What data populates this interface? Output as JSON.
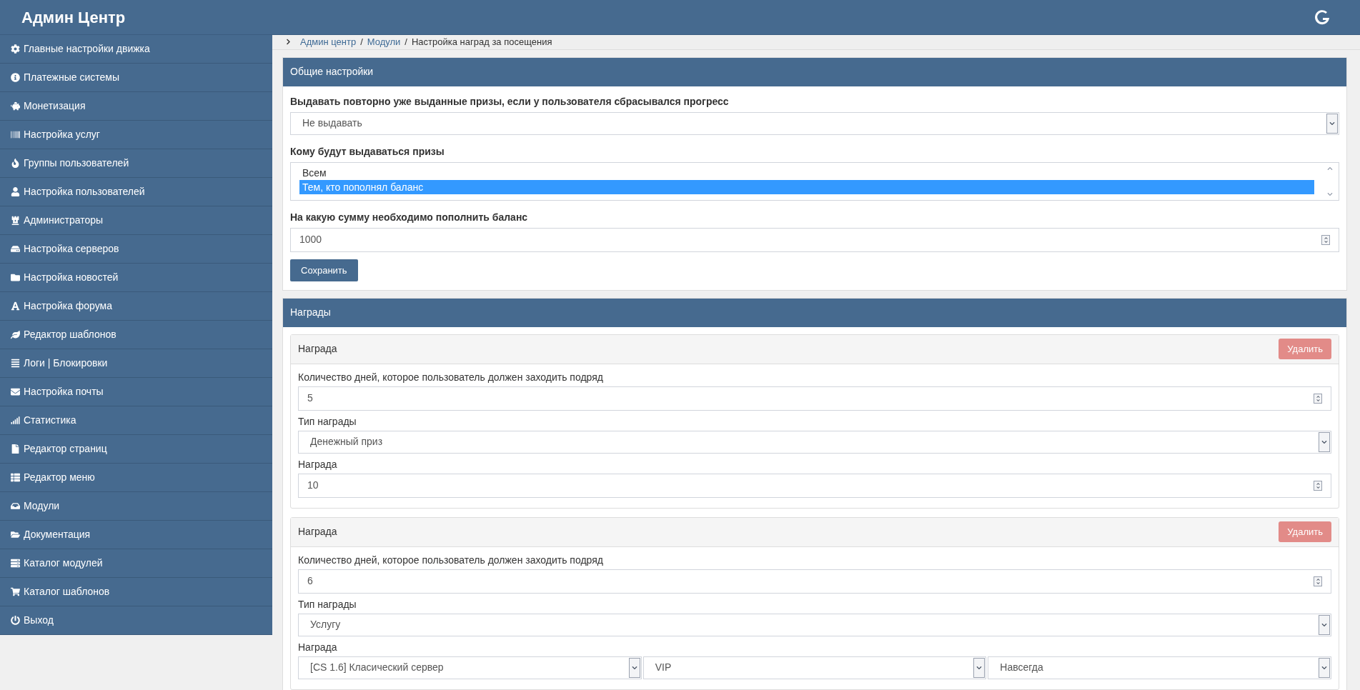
{
  "header": {
    "title": "Админ Центр"
  },
  "sidebar": {
    "items": [
      {
        "label": "Главные настройки движка"
      },
      {
        "label": "Платежные системы"
      },
      {
        "label": "Монетизация"
      },
      {
        "label": "Настройка услуг"
      },
      {
        "label": "Группы пользователей"
      },
      {
        "label": "Настройка пользователей"
      },
      {
        "label": "Администраторы"
      },
      {
        "label": "Настройка серверов"
      },
      {
        "label": "Настройка новостей"
      },
      {
        "label": "Настройка форума"
      },
      {
        "label": "Редактор шаблонов"
      },
      {
        "label": "Логи | Блокировки"
      },
      {
        "label": "Настройка почты"
      },
      {
        "label": "Статистика"
      },
      {
        "label": "Редактор страниц"
      },
      {
        "label": "Редактор меню"
      },
      {
        "label": "Модули"
      },
      {
        "label": "Документация"
      },
      {
        "label": "Каталог модулей"
      },
      {
        "label": "Каталог шаблонов"
      },
      {
        "label": "Выход"
      }
    ]
  },
  "breadcrumb": {
    "links": [
      "Админ центр",
      "Модули"
    ],
    "separator": "/",
    "current": "Настройка наград за посещения"
  },
  "general_settings": {
    "title": "Общие настройки",
    "fields": [
      {
        "kind": "select",
        "label": "Выдавать повторно уже выданные призы, если у пользователя сбрасывался прогресс",
        "value": "Не выдавать"
      },
      {
        "kind": "listbox",
        "label": "Кому будут выдаваться призы",
        "options": [
          {
            "label": "Всем",
            "selected": false
          },
          {
            "label": "Тем, кто пополнял баланс",
            "selected": true
          }
        ]
      },
      {
        "kind": "number",
        "label": "На какую сумму необходимо пополнить баланс",
        "value": "1000"
      }
    ],
    "save_button": "Сохранить"
  },
  "rewards": {
    "title": "Награды",
    "cards": [
      {
        "title": "Награда",
        "delete_button": "Удалить",
        "fields": [
          {
            "kind": "number",
            "label": "Количество дней, которое пользователь должен заходить подряд",
            "value": "5"
          },
          {
            "kind": "select",
            "label": "Тип награды",
            "value": "Денежный приз"
          },
          {
            "kind": "number",
            "label": "Награда",
            "value": "10"
          }
        ]
      },
      {
        "title": "Награда",
        "delete_button": "Удалить",
        "fields": [
          {
            "kind": "number",
            "label": "Количество дней, которое пользователь должен заходить подряд",
            "value": "6"
          },
          {
            "kind": "select",
            "label": "Тип награды",
            "value": "Услугу"
          },
          {
            "kind": "multi-select",
            "label": "Награда",
            "values": [
              "[CS 1.6] Класический сервер",
              "VIP",
              "Навсегда"
            ]
          }
        ]
      }
    ]
  }
}
